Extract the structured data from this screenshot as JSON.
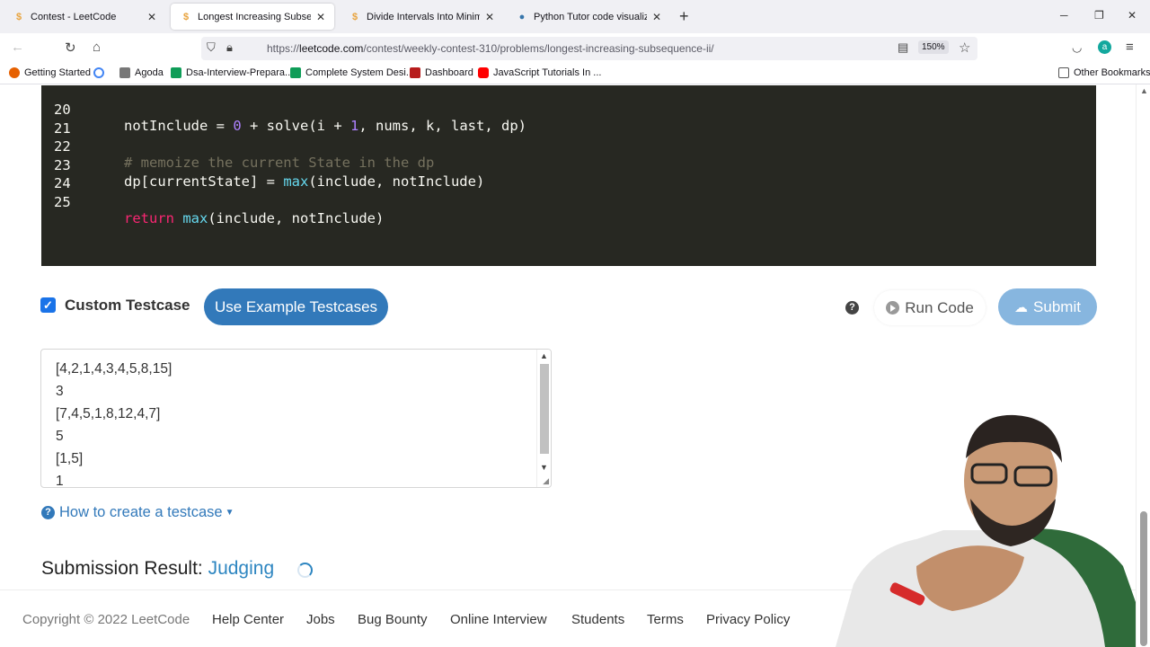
{
  "browser": {
    "tabs": [
      {
        "title": "Contest - LeetCode",
        "active": false
      },
      {
        "title": "Longest Increasing Subsequenc",
        "active": true
      },
      {
        "title": "Divide Intervals Into Minimum N",
        "active": false
      },
      {
        "title": "Python Tutor code visualizer: Vi",
        "active": false
      }
    ],
    "url_prefix": "https://",
    "url_host": "leetcode.com",
    "url_path": "/contest/weekly-contest-310/problems/longest-increasing-subsequence-ii/",
    "zoom": "150%",
    "bookmarks": [
      {
        "label": "Getting Started",
        "color": "#e66000"
      },
      {
        "label": "",
        "color": "#4285f4"
      },
      {
        "label": "Agoda",
        "color": "#777777"
      },
      {
        "label": "Dsa-Interview-Prepara...",
        "color": "#0f9d58"
      },
      {
        "label": "Complete System Desi...",
        "color": "#0f9d58"
      },
      {
        "label": "Dashboard",
        "color": "#b71c1c"
      },
      {
        "label": "JavaScript Tutorials In ...",
        "color": "#ff0000"
      }
    ],
    "other_bookmarks": "Other Bookmarks"
  },
  "editor": {
    "lines": [
      {
        "n": "20",
        "plain_a": "notInclude = ",
        "num_a": "0",
        "plain_b": " + solve(i + ",
        "num_b": "1",
        "plain_c": ", nums, k, last, dp)"
      },
      {
        "n": "21"
      },
      {
        "n": "22",
        "comment": "# memoize the current State in the dp"
      },
      {
        "n": "23",
        "pre": "dp[currentState] = ",
        "fn": "max",
        "post": "(include, notInclude)"
      },
      {
        "n": "24"
      },
      {
        "n": "25",
        "kw": "return",
        "fn": "max",
        "post": "(include, notInclude)"
      }
    ]
  },
  "controls": {
    "custom_testcase_label": "Custom Testcase",
    "use_example_label": "Use Example Testcases",
    "run_label": "Run Code",
    "submit_label": "Submit"
  },
  "testcase": {
    "lines": [
      "[4,2,1,4,3,4,5,8,15]",
      "3",
      "[7,4,5,1,8,12,4,7]",
      "5",
      "[1,5]",
      "1"
    ]
  },
  "howto_label": "How to create a testcase",
  "submission": {
    "label": "Submission Result: ",
    "status": "Judging"
  },
  "footer": {
    "copyright": "Copyright © 2022 LeetCode",
    "links": [
      "Help Center",
      "Jobs",
      "Bug Bounty",
      "Online Interview",
      "Students",
      "Terms",
      "Privacy Policy"
    ]
  }
}
